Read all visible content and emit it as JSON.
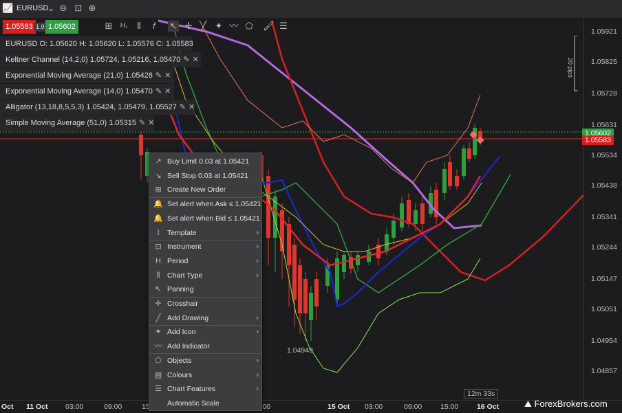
{
  "symbol": "EURUSD",
  "bid_price": "1.05583",
  "spread": "1.9",
  "ask_price": "1.05602",
  "ohlc": "EURUSD  O: 1.05620  H: 1.05620  L: 1.05576  C: 1.05583",
  "indicators": [
    "Keltner Channel (14,2,0) 1.05724, 1.05216, 1.05470",
    "Exponential Moving Average (21,0) 1.05428",
    "Exponential Moving Average (14,0) 1.05470",
    "Alligator (13,18,8,5,5,3) 1.05424, 1.05479, 1.05527",
    "Simple Moving Average (51,0) 1.05315"
  ],
  "y_axis": [
    "1.05921",
    "1.05825",
    "1.05728",
    "1.05631",
    "1.05534",
    "1.05438",
    "1.05341",
    "1.05244",
    "1.05147",
    "1.05051",
    "1.04954",
    "1.04857"
  ],
  "price_tags": {
    "ask": "1.05602",
    "bid": "1.05583"
  },
  "x_axis": [
    "Oct",
    "11 Oct",
    "03:00",
    "09:00",
    "15:00",
    "21:00",
    "15 Oct",
    "03:00",
    "09:00",
    "15:00",
    "16 Oct"
  ],
  "pips_label": "20 pips",
  "min_label": "1.04949",
  "timer": "12m 33s",
  "brand": "ForexBrokers.com",
  "context_menu": [
    {
      "label": "Buy Limit 0.03 at 1.05421",
      "icon": "buy-limit-icon",
      "sub": false
    },
    {
      "label": "Sell Stop 0.03 at 1.05421",
      "icon": "sell-stop-icon",
      "sub": false
    },
    {
      "label": "Create New Order",
      "icon": "new-order-icon",
      "sub": false
    },
    {
      "label": "Set alert when Ask ≤ 1.05421",
      "icon": "bell-icon",
      "sub": false
    },
    {
      "label": "Set alert when Bid ≤ 1.05421",
      "icon": "bell-icon",
      "sub": false
    },
    {
      "label": "Template",
      "icon": "template-icon",
      "sub": true
    },
    {
      "label": "Instrument",
      "icon": "instrument-icon",
      "sub": true
    },
    {
      "label": "Period",
      "icon": "period-icon",
      "sub": true
    },
    {
      "label": "Chart Type",
      "icon": "chart-type-icon",
      "sub": true
    },
    {
      "label": "Panning",
      "icon": "pan-icon",
      "sub": false
    },
    {
      "label": "Crosshair",
      "icon": "crosshair-icon",
      "sub": false
    },
    {
      "label": "Add Drawing",
      "icon": "drawing-icon",
      "sub": true
    },
    {
      "label": "Add Icon",
      "icon": "add-icon-icon",
      "sub": true
    },
    {
      "label": "Add Indicator",
      "icon": "indicator-icon",
      "sub": false
    },
    {
      "label": "Objects",
      "icon": "objects-icon",
      "sub": true
    },
    {
      "label": "Colours",
      "icon": "colours-icon",
      "sub": true
    },
    {
      "label": "Chart Features",
      "icon": "features-icon",
      "sub": true
    },
    {
      "label": "Automatic Scale",
      "icon": "none",
      "sub": false
    }
  ],
  "colors": {
    "bid": "#e02828",
    "ask": "#2ea043",
    "up": "#2e9f3e",
    "down": "#e0372b",
    "purple": "#b36ae2",
    "blue": "#1c27d6",
    "yellow": "#d9c235",
    "salmon": "#e07a62",
    "lime": "#8ee65a"
  }
}
